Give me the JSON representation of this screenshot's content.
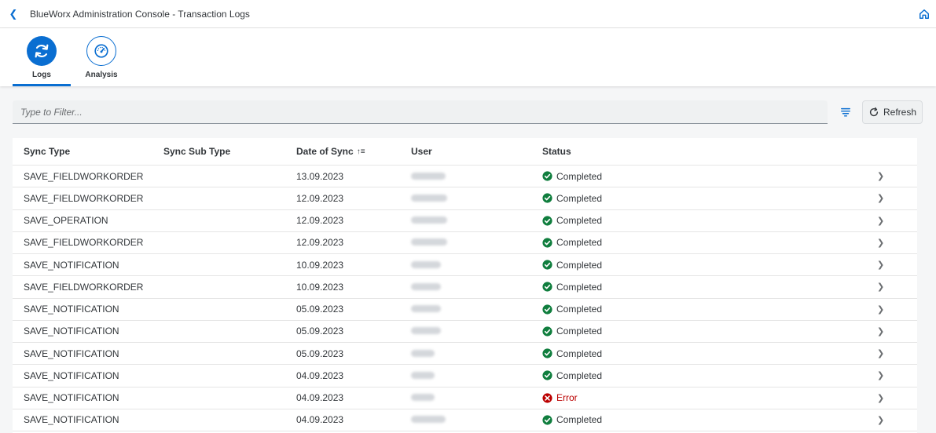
{
  "shell": {
    "title": "BlueWorx Administration Console - Transaction Logs"
  },
  "tabs": [
    {
      "label": "Logs",
      "icon": "sync-icon",
      "active": true
    },
    {
      "label": "Analysis",
      "icon": "gauge-icon",
      "active": false
    }
  ],
  "toolbar": {
    "filter_placeholder": "Type to Filter...",
    "refresh_label": "Refresh"
  },
  "table": {
    "columns": [
      "Sync Type",
      "Sync Sub Type",
      "Date of Sync",
      "User",
      "Status"
    ],
    "sort_indicator": "↑≡",
    "rows": [
      {
        "sync_type": "SAVE_FIELDWORKORDER",
        "sub_type": "",
        "date": "13.09.2023",
        "status": "Completed"
      },
      {
        "sync_type": "SAVE_FIELDWORKORDER",
        "sub_type": "",
        "date": "12.09.2023",
        "status": "Completed"
      },
      {
        "sync_type": "SAVE_OPERATION",
        "sub_type": "",
        "date": "12.09.2023",
        "status": "Completed"
      },
      {
        "sync_type": "SAVE_FIELDWORKORDER",
        "sub_type": "",
        "date": "12.09.2023",
        "status": "Completed"
      },
      {
        "sync_type": "SAVE_NOTIFICATION",
        "sub_type": "",
        "date": "10.09.2023",
        "status": "Completed"
      },
      {
        "sync_type": "SAVE_FIELDWORKORDER",
        "sub_type": "",
        "date": "10.09.2023",
        "status": "Completed"
      },
      {
        "sync_type": "SAVE_NOTIFICATION",
        "sub_type": "",
        "date": "05.09.2023",
        "status": "Completed"
      },
      {
        "sync_type": "SAVE_NOTIFICATION",
        "sub_type": "",
        "date": "05.09.2023",
        "status": "Completed"
      },
      {
        "sync_type": "SAVE_NOTIFICATION",
        "sub_type": "",
        "date": "05.09.2023",
        "status": "Completed"
      },
      {
        "sync_type": "SAVE_NOTIFICATION",
        "sub_type": "",
        "date": "04.09.2023",
        "status": "Completed"
      },
      {
        "sync_type": "SAVE_NOTIFICATION",
        "sub_type": "",
        "date": "04.09.2023",
        "status": "Error"
      },
      {
        "sync_type": "SAVE_NOTIFICATION",
        "sub_type": "",
        "date": "04.09.2023",
        "status": "Completed"
      }
    ]
  },
  "colors": {
    "brand": "#0a6ed1",
    "success": "#107e3e",
    "error": "#bb0000"
  }
}
